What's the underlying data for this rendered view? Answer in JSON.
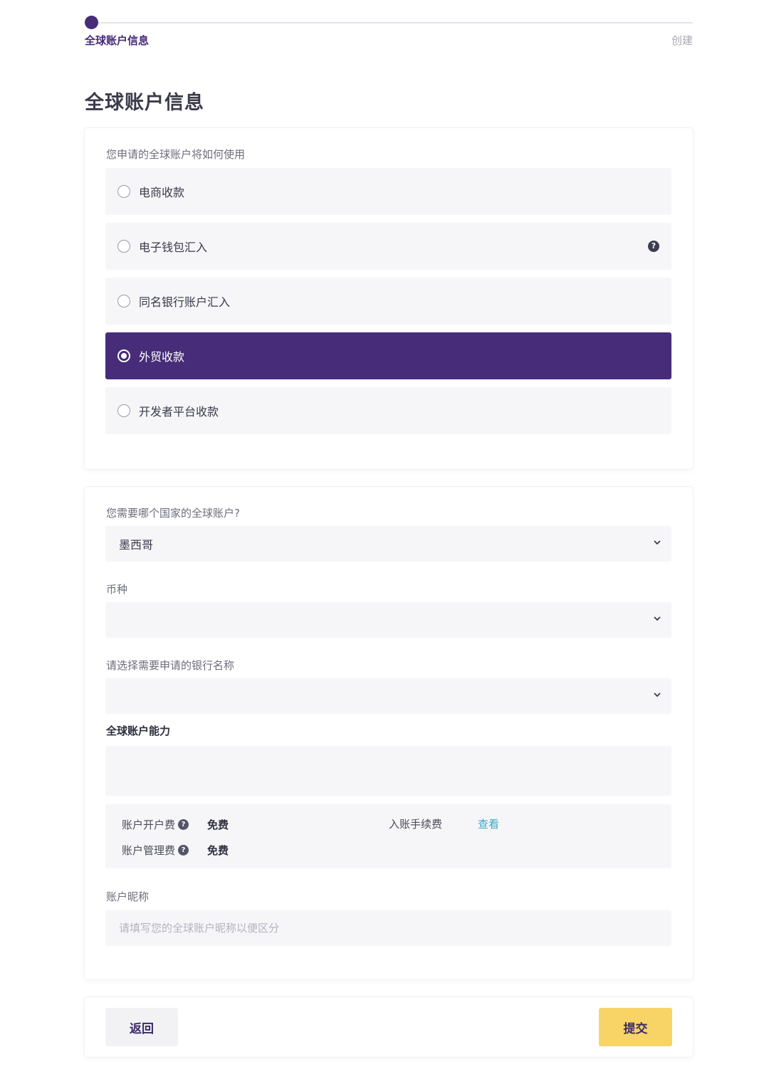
{
  "stepper": {
    "step1_label": "全球账户信息",
    "step2_label": "创建"
  },
  "page_title": "全球账户信息",
  "usage": {
    "label": "您申请的全球账户将如何使用",
    "options": [
      {
        "label": "电商收款",
        "selected": false
      },
      {
        "label": "电子钱包汇入",
        "selected": false,
        "help_icon": "?"
      },
      {
        "label": "同名银行账户汇入",
        "selected": false
      },
      {
        "label": "外贸收款",
        "selected": true
      },
      {
        "label": "开发者平台收款",
        "selected": false
      }
    ]
  },
  "country": {
    "label": "您需要哪个国家的全球账户?",
    "value": "墨西哥"
  },
  "currency": {
    "label": "币种",
    "value": ""
  },
  "bank": {
    "label": "请选择需要申请的银行名称",
    "value": ""
  },
  "capability": {
    "label": "全球账户能力"
  },
  "fees": {
    "open_fee_label": "账户开户费",
    "open_fee_value": "免费",
    "manage_fee_label": "账户管理费",
    "manage_fee_value": "免费",
    "incoming_fee_label": "入账手续费",
    "incoming_fee_link": "查看",
    "help_glyph": "?"
  },
  "nickname": {
    "label": "账户昵称",
    "placeholder": "请填写您的全球账户昵称以便区分"
  },
  "actions": {
    "back_label": "返回",
    "submit_label": "提交"
  },
  "colors": {
    "brand_purple": "#472c7a",
    "submit_yellow": "#f8d466",
    "link_blue": "#3aa7c8"
  }
}
